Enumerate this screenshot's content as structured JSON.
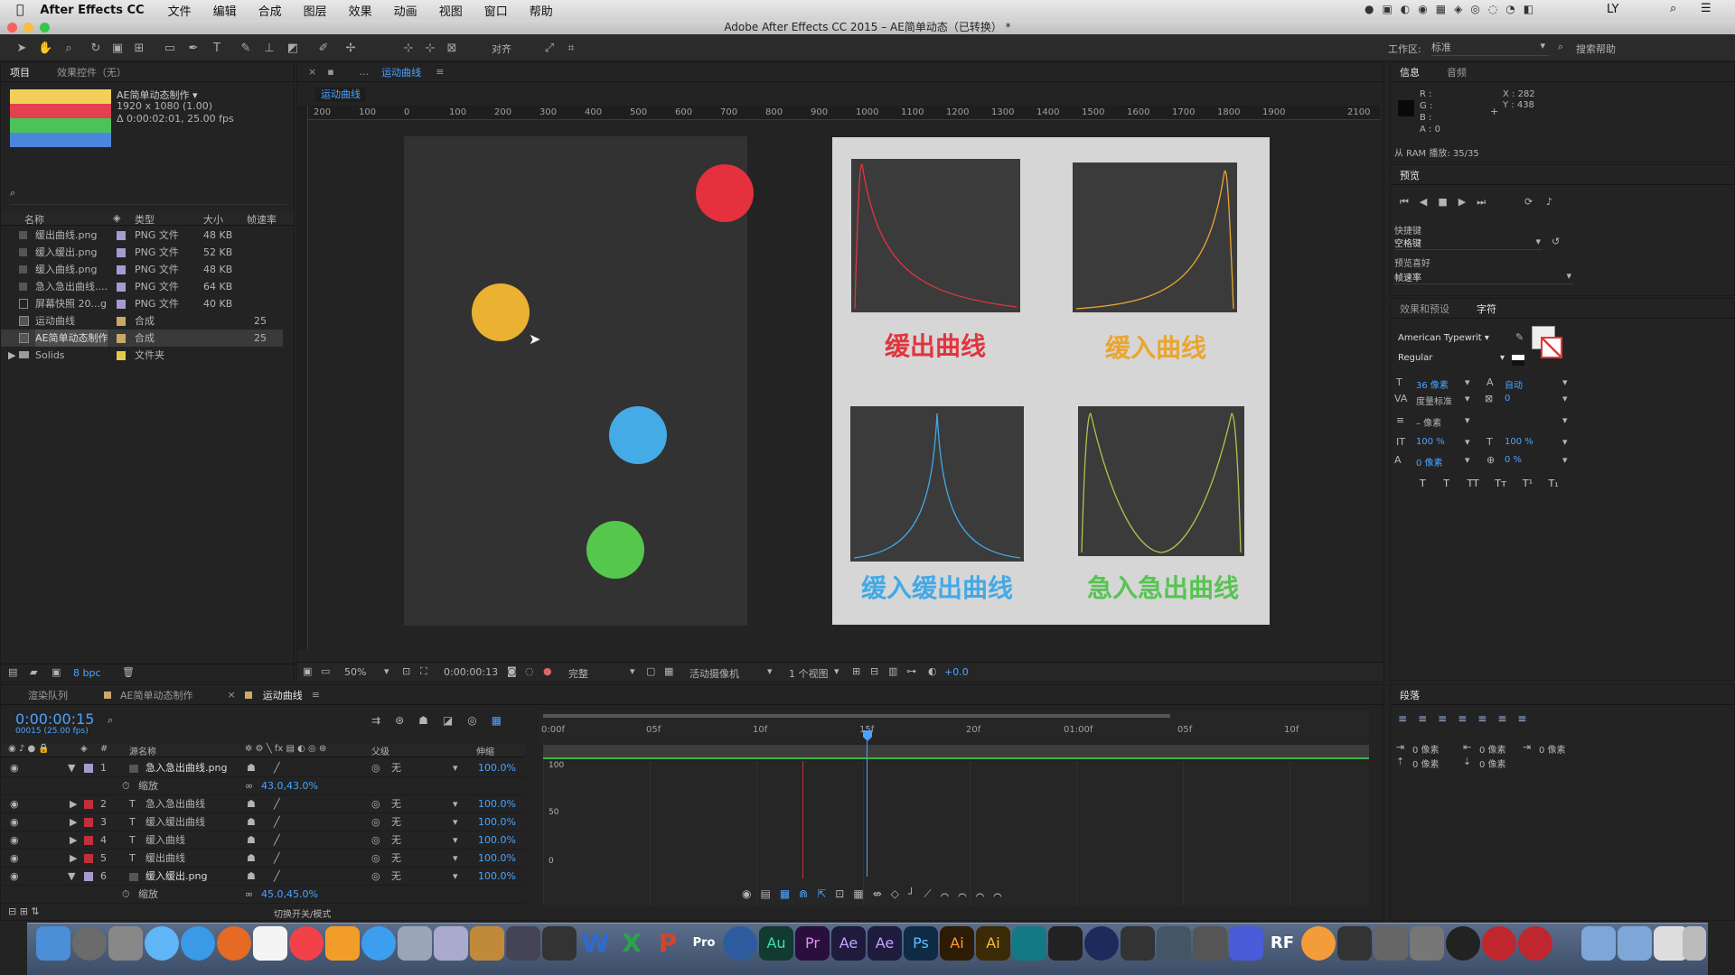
{
  "menubar": {
    "app": "After Effects CC",
    "items": [
      "文件",
      "编辑",
      "合成",
      "图层",
      "效果",
      "动画",
      "视图",
      "窗口",
      "帮助"
    ],
    "user": "LY"
  },
  "window": {
    "title": "Adobe After Effects CC 2015 – AE简单动态（已转换） *"
  },
  "toolbar": {
    "align_label": "对齐",
    "workspace_label": "工作区:",
    "workspace_value": "标准",
    "search_help": "搜索帮助"
  },
  "project": {
    "tabs": [
      "项目",
      "效果控件（无）"
    ],
    "comp_name": "AE简单动态制作 ▾",
    "comp_res": "1920 x 1080 (1.00)",
    "comp_dur": "Δ 0:00:02:01, 25.00 fps",
    "columns": [
      "名称",
      "类型",
      "大小",
      "帧速率"
    ],
    "items": [
      {
        "name": "缓出曲线.png",
        "type": "PNG 文件",
        "size": "48 KB",
        "fps": ""
      },
      {
        "name": "缓入缓出.png",
        "type": "PNG 文件",
        "size": "52 KB",
        "fps": ""
      },
      {
        "name": "缓入曲线.png",
        "type": "PNG 文件",
        "size": "48 KB",
        "fps": ""
      },
      {
        "name": "急入急出曲线....",
        "type": "PNG 文件",
        "size": "64 KB",
        "fps": ""
      },
      {
        "name": "屏幕快照 20...g",
        "type": "PNG 文件",
        "size": "40 KB",
        "fps": ""
      },
      {
        "name": "运动曲线",
        "type": "合成",
        "size": "",
        "fps": "25"
      },
      {
        "name": "AE简单动态制作",
        "type": "合成",
        "size": "",
        "fps": "25"
      },
      {
        "name": "Solids",
        "type": "文件夹",
        "size": "",
        "fps": ""
      }
    ],
    "bpc": "8 bpc"
  },
  "comp": {
    "tab_prefix": "...",
    "tab": "运动曲线",
    "sub_tab": "运动曲线",
    "ruler": [
      "200",
      "100",
      "0",
      "100",
      "200",
      "300",
      "400",
      "500",
      "600",
      "700",
      "800",
      "900",
      "1000",
      "1100",
      "1200",
      "1300",
      "1400",
      "1500",
      "1600",
      "1700",
      "1800",
      "1900",
      "2100"
    ],
    "zoom": "50%",
    "time": "0:00:00:13",
    "quality": "完整",
    "camera": "活动摄像机",
    "views": "1 个视图",
    "exposure": "+0.0",
    "cards": [
      {
        "label": "缓出曲线",
        "color": "#e0363f"
      },
      {
        "label": "缓入曲线",
        "color": "#eaa531"
      },
      {
        "label": "缓入缓出曲线",
        "color": "#43a9e6"
      },
      {
        "label": "急入急出曲线",
        "color": "#57c451"
      }
    ]
  },
  "info": {
    "tabs": [
      "信息",
      "音频"
    ],
    "r": "R :",
    "g": "G :",
    "b": "B :",
    "a": "A : 0",
    "x": "X : 282",
    "y": "Y : 438",
    "ram": "从 RAM 播放: 35/35"
  },
  "preview": {
    "title": "预览",
    "shortcut_label": "快捷键",
    "shortcut": "空格键",
    "pref_label": "预览喜好",
    "pref": "帧速率"
  },
  "character": {
    "tabs": [
      "效果和预设",
      "字符"
    ],
    "font": "American Typewrit",
    "style": "Regular",
    "size": "36 像素",
    "leading": "自动",
    "kerning": "度量标准",
    "tracking": "0",
    "stroke": "– 像素",
    "vscale": "100 %",
    "hscale": "100 %",
    "baseline": "0 像素",
    "tsume": "0 %",
    "styles": [
      "T",
      "T",
      "TT",
      "Tт",
      "T¹",
      "T₁"
    ]
  },
  "paragraph": {
    "title": "段落",
    "indent": [
      "0 像素",
      "0 像素",
      "0 像素",
      "0 像素",
      "0 像素"
    ]
  },
  "timeline": {
    "tabs": [
      "渲染队列",
      "AE简单动态制作",
      "运动曲线"
    ],
    "time": "0:00:00:15",
    "frames": "00015 (25.00 fps)",
    "columns": [
      "源名称",
      "父级",
      "伸缩"
    ],
    "rows": [
      {
        "num": "1",
        "name": "急入急出曲线.png",
        "color": "#a89acf",
        "parent": "无",
        "stretch": "100.0%"
      },
      {
        "num": "",
        "name": "缩放",
        "color": "",
        "parent": "",
        "stretch": "",
        "value": "43.0,43.0%"
      },
      {
        "num": "2",
        "name": "急入急出曲线",
        "color": "#c0303c",
        "parent": "无",
        "stretch": "100.0%"
      },
      {
        "num": "3",
        "name": "缓入缓出曲线",
        "color": "#c0303c",
        "parent": "无",
        "stretch": "100.0%"
      },
      {
        "num": "4",
        "name": "缓入曲线",
        "color": "#c0303c",
        "parent": "无",
        "stretch": "100.0%"
      },
      {
        "num": "5",
        "name": "缓出曲线",
        "color": "#c0303c",
        "parent": "无",
        "stretch": "100.0%"
      },
      {
        "num": "6",
        "name": "缓入缓出.png",
        "color": "#a89acf",
        "parent": "无",
        "stretch": "100.0%"
      },
      {
        "num": "",
        "name": "缩放",
        "color": "",
        "parent": "",
        "stretch": "",
        "value": "45.0,45.0%"
      }
    ],
    "ruler": [
      "0:00f",
      "05f",
      "10f",
      "15f",
      "20f",
      "01:00f",
      "05f",
      "10f"
    ],
    "graph_y": [
      "100",
      "50",
      "0"
    ],
    "toggle_label": "切换开关/模式"
  },
  "dock": {
    "labels": [
      "W",
      "X",
      "P",
      "Pro",
      "Au",
      "Pr",
      "Ae",
      "Ae",
      "Ps",
      "Ai",
      "Ai",
      "RF"
    ]
  }
}
